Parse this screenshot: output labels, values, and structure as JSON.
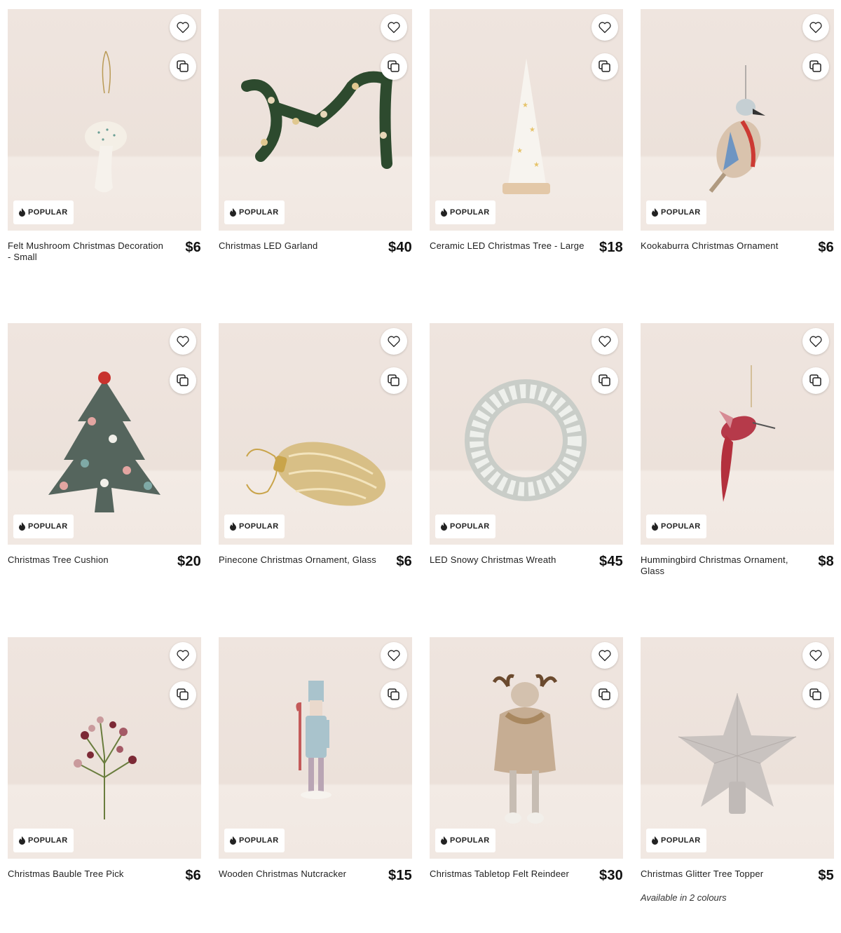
{
  "badge_label": "POPULAR",
  "products": [
    {
      "title": "Felt Mushroom Christmas Decoration - Small",
      "price": "$6",
      "art": "mushroom-ornament"
    },
    {
      "title": "Christmas LED Garland",
      "price": "$40",
      "art": "garland"
    },
    {
      "title": "Ceramic LED Christmas Tree - Large",
      "price": "$18",
      "art": "ceramic-tree"
    },
    {
      "title": "Kookaburra Christmas Ornament",
      "price": "$6",
      "art": "kookaburra"
    },
    {
      "title": "Christmas Tree Cushion",
      "price": "$20",
      "art": "tree-cushion"
    },
    {
      "title": "Pinecone Christmas Ornament, Glass",
      "price": "$6",
      "art": "pinecone"
    },
    {
      "title": "LED Snowy Christmas Wreath",
      "price": "$45",
      "art": "wreath"
    },
    {
      "title": "Hummingbird Christmas Ornament, Glass",
      "price": "$8",
      "art": "hummingbird"
    },
    {
      "title": "Christmas Bauble Tree Pick",
      "price": "$6",
      "art": "berry-pick"
    },
    {
      "title": "Wooden Christmas Nutcracker",
      "price": "$15",
      "art": "nutcracker"
    },
    {
      "title": "Christmas Tabletop Felt Reindeer",
      "price": "$30",
      "art": "reindeer"
    },
    {
      "title": "Christmas Glitter Tree Topper",
      "price": "$5",
      "art": "star-topper",
      "availability": "Available in 2 colours"
    }
  ]
}
